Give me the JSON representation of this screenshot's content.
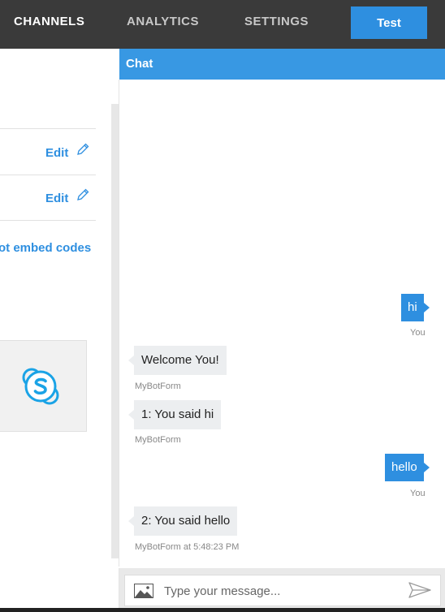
{
  "nav": {
    "items": [
      {
        "label": "CHANNELS"
      },
      {
        "label": "ANALYTICS"
      },
      {
        "label": "SETTINGS"
      }
    ],
    "test_label": "Test"
  },
  "left": {
    "rows": [
      {
        "edit_label": "Edit"
      },
      {
        "edit_label": "Edit"
      }
    ],
    "embed_link": "ot embed codes",
    "skype_icon": "skype-icon"
  },
  "chat": {
    "title": "Chat",
    "messages": [
      {
        "from": "user",
        "text": "hi",
        "meta": "You"
      },
      {
        "from": "bot",
        "text": "Welcome You!",
        "meta": "MyBotForm"
      },
      {
        "from": "bot",
        "text": "1: You said hi",
        "meta": "MyBotForm"
      },
      {
        "from": "user",
        "text": "hello",
        "meta": "You"
      },
      {
        "from": "bot",
        "text": "2: You said hello",
        "meta": "MyBotForm at 5:48:23 PM"
      }
    ],
    "input_placeholder": "Type your message...",
    "input_value": ""
  },
  "colors": {
    "accent": "#2e8fe0",
    "header": "#3898e3",
    "topbar": "#3a3a3a",
    "bot_bubble": "#eceef0"
  }
}
